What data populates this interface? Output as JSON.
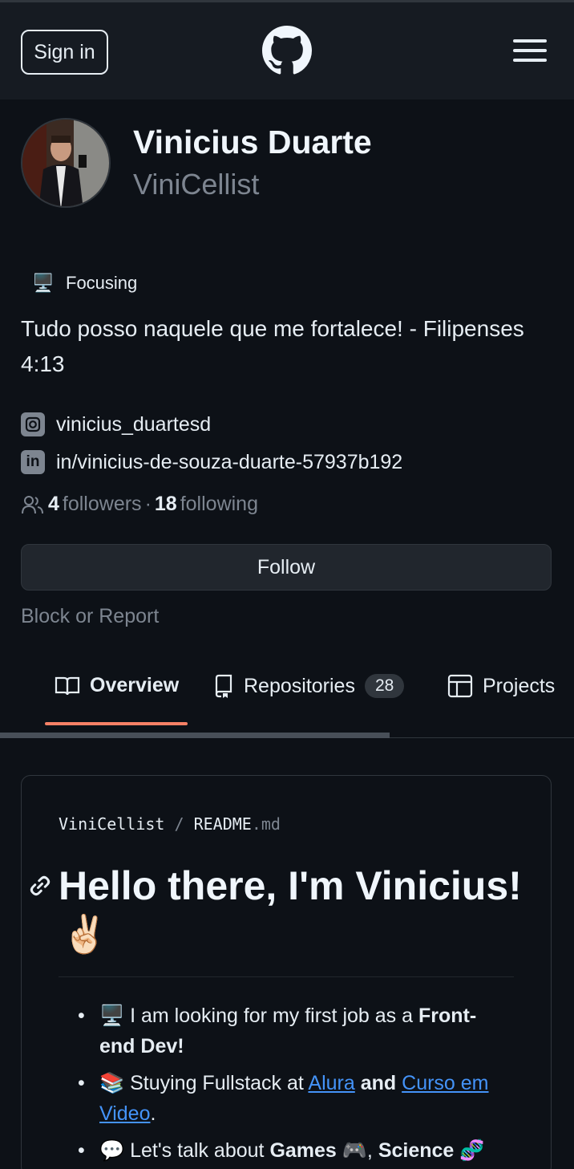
{
  "header": {
    "signin_label": "Sign in"
  },
  "profile": {
    "name": "Vinicius Duarte",
    "login": "ViniCellist",
    "status_emoji": "🖥️",
    "status_text": "Focusing",
    "bio": "Tudo posso naquele que me fortalece! - Filipenses 4:13",
    "social": [
      {
        "icon": "instagram-icon",
        "text": "vinicius_duartesd"
      },
      {
        "icon": "linkedin-icon",
        "text": "in/vinicius-de-souza-duarte-57937b192"
      }
    ],
    "followers_count": "4",
    "followers_label": "followers",
    "dot": "·",
    "following_count": "18",
    "following_label": "following",
    "follow_label": "Follow",
    "block_label": "Block or Report"
  },
  "tabs": [
    {
      "label": "Overview",
      "icon": "book-icon",
      "active": true
    },
    {
      "label": "Repositories",
      "icon": "repo-icon",
      "count": "28"
    },
    {
      "label": "Projects",
      "icon": "table-icon"
    }
  ],
  "readme": {
    "path_user": "ViniCellist",
    "path_sep": "/",
    "path_file": "README",
    "path_ext": ".md",
    "heading": "Hello there, I'm Vinicius!",
    "heading_emoji": "✌🏻",
    "items": [
      {
        "emoji": "🖥️",
        "pre": "I am looking for my first job as a ",
        "bold": "Front-end Dev!"
      },
      {
        "emoji": "📚",
        "pre": "Stuying Fullstack at ",
        "link1": "Alura",
        "mid": " and ",
        "link2": "Curso em Video",
        "post": "."
      },
      {
        "emoji": "💬",
        "pre": "Let's talk about ",
        "bold1": "Games",
        "emoji2": "🎮",
        "mid": ", ",
        "bold2": "Science",
        "emoji3": "🧬"
      }
    ]
  }
}
